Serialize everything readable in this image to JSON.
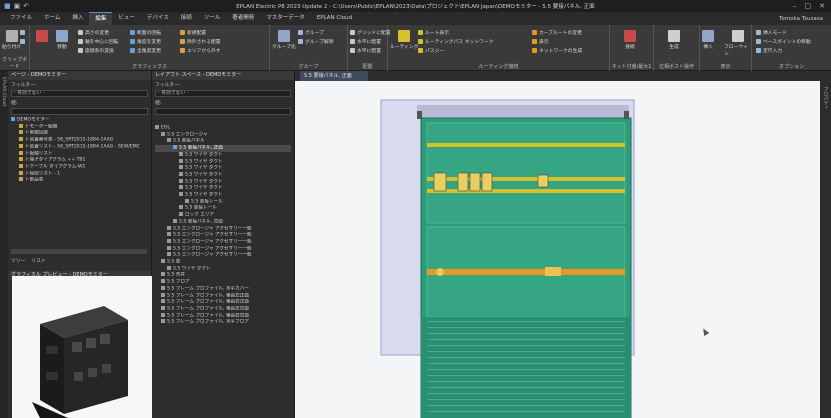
{
  "title": "EPLAN Electric P8 2023 Update 2 - C:\\Users\\Public\\EPLAN\\2023\\Data\\プロジェクト\\EPLAN Japan\\DEMOモミター - 5.5 要接パネル, 正面",
  "menu": {
    "tabs": [
      "ファイル",
      "ホーム",
      "挿入",
      "編集",
      "ビュー",
      "デバイス",
      "接続",
      "ツール",
      "著者開発",
      "マスターデータ",
      "EPLAN Cloud"
    ],
    "active": "編集",
    "user": "Tomoka Tsuzasa"
  },
  "ribbon": {
    "groups": [
      {
        "label": "クリップボード"
      },
      {
        "label": "グラフィックス"
      },
      {
        "label": "グループ"
      },
      {
        "label": "配置"
      },
      {
        "label": "ルーティング接続"
      },
      {
        "label": "ネット付番/最大1"
      },
      {
        "label": "位相ポスト操作"
      },
      {
        "label": "表示"
      },
      {
        "label": "オプション"
      }
    ],
    "buttons": {
      "paste": "貼り付け",
      "move": "移動",
      "group": "グループ化",
      "group2": "グループ",
      "ungroup": "グループ解除",
      "routing": "ルーティング",
      "net": "接続",
      "generate": "生成",
      "insert": "挿入",
      "flow": "フローウィン",
      "tab_enter": "挿入モード"
    },
    "small": [
      "高さの変更",
      "断面の回転",
      "新規配置",
      "軸を中心に回転",
      "角度を変更",
      "除外される配置",
      "座標系の変換",
      "全角度変更",
      "エリアから外す",
      "グリッドに配置",
      "水平に配置",
      "水平に配置",
      "ルート表示",
      "ルーティングパス ネットワーク",
      "パスジー",
      "カーブルートの変更",
      "表示",
      "ネットワークの生成",
      "ベースポイントの移動",
      "定尺入力"
    ]
  },
  "doc_tab": "5.5 要接パネル, 正面",
  "left_strip": "EPLAN Cloud",
  "pages_panel": {
    "header": "ページ - DEMOモミター",
    "filter_label": "フィルター:",
    "filter_value": "- 有効でない -",
    "value_label": "値:",
    "tree": [
      "DEMOモミター",
      "トモーター組織",
      "ト制御回路",
      "ト装置番号表 - 58_SRT2015-1884-1AAG",
      "ト装置リスト - 58_SRT2015-1884-1AAG - SEW/EMC",
      "ト配線リスト",
      "ト端子ダイアグラム ++ TB1",
      "トケーブル ダイアグラム-W1",
      "ト接続リスト - 1",
      "ト部品表"
    ],
    "tabs": [
      "ツリー",
      "リスト"
    ]
  },
  "layout_panel": {
    "header": "レイアウト スペース - DEMOモミター",
    "filter_label": "フィルター:",
    "filter_value": "- 有効でない -",
    "value_label": "値:",
    "tree": [
      "EOL",
      "5.5 エンクロージャ",
      "5.5 要接パネル",
      "5.5 要接パネル, 正面",
      "5.5 ワイヤ ダクト",
      "5.5 ワイヤ ダクト",
      "5.5 ワイヤ ダクト",
      "5.5 ワイヤ ダクト",
      "5.5 ワイヤ ダクト",
      "5.5 ワイヤ ダクト",
      "5.5 ワイヤ ダクト",
      "5.5 要接レール",
      "5.5 要接レール",
      "ロック エリア",
      "5.5 要接パネル, 背面",
      "5.5 エンクロージャ アクセサリー一般",
      "5.5 エンクロージャ アクセサリー一般",
      "5.5 エンクロージャ アクセサリー一般",
      "5.5 エンクロージャ アクセサリー一般",
      "5.5 エンクロージャ アクセサリー一般",
      "5.5 扉",
      "5.5 ワイヤ ダクト",
      "5.5 天井",
      "5.5 フロア",
      "5.5 フレーム プロファイル, 水平カバー",
      "5.5 フレーム プロファイル, 垂直左正面",
      "5.5 フレーム プロファイル, 垂直右正面",
      "5.5 フレーム プロファイル, 垂直左背面",
      "5.5 フレーム プロファイル, 垂直右背面",
      "5.5 フレーム プロファイル, 水平フロア"
    ]
  },
  "preview_panel": {
    "header": "グラフィカル プレビュー - DEMOモミター"
  },
  "right_strip": "プロパティ",
  "colors": {
    "panel_green": "#2f9b7a",
    "duct_yellow": "#d8c02a",
    "rail_orange": "#e69a1c",
    "door_lavender": "#d9dcf0"
  }
}
